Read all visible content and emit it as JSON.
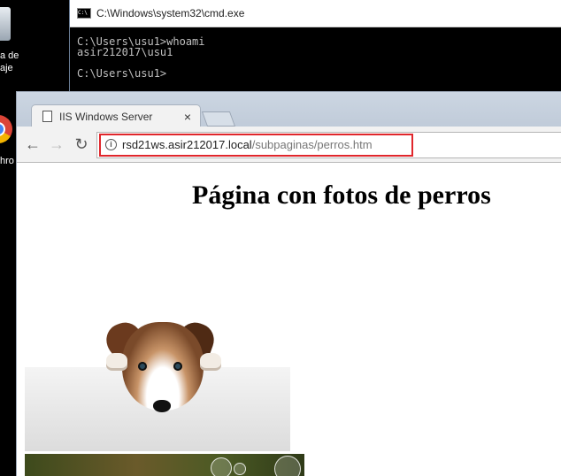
{
  "desktop": {
    "recycle_label": "a de\naje",
    "chrome_label": "hro"
  },
  "cmd": {
    "title": "C:\\Windows\\system32\\cmd.exe",
    "lines": [
      "C:\\Users\\usu1>whoami",
      "asir212017\\usu1",
      "",
      "C:\\Users\\usu1>"
    ]
  },
  "browser": {
    "tab_title": "IIS Windows Server",
    "tab_close": "×",
    "url_host": "rsd21ws.asir212017.local",
    "url_path": "/subpaginas/perros.htm",
    "back": "←",
    "forward": "→",
    "reload": "↻",
    "highlight_color": "#e0262b"
  },
  "page": {
    "heading": "Página con fotos de perros"
  }
}
